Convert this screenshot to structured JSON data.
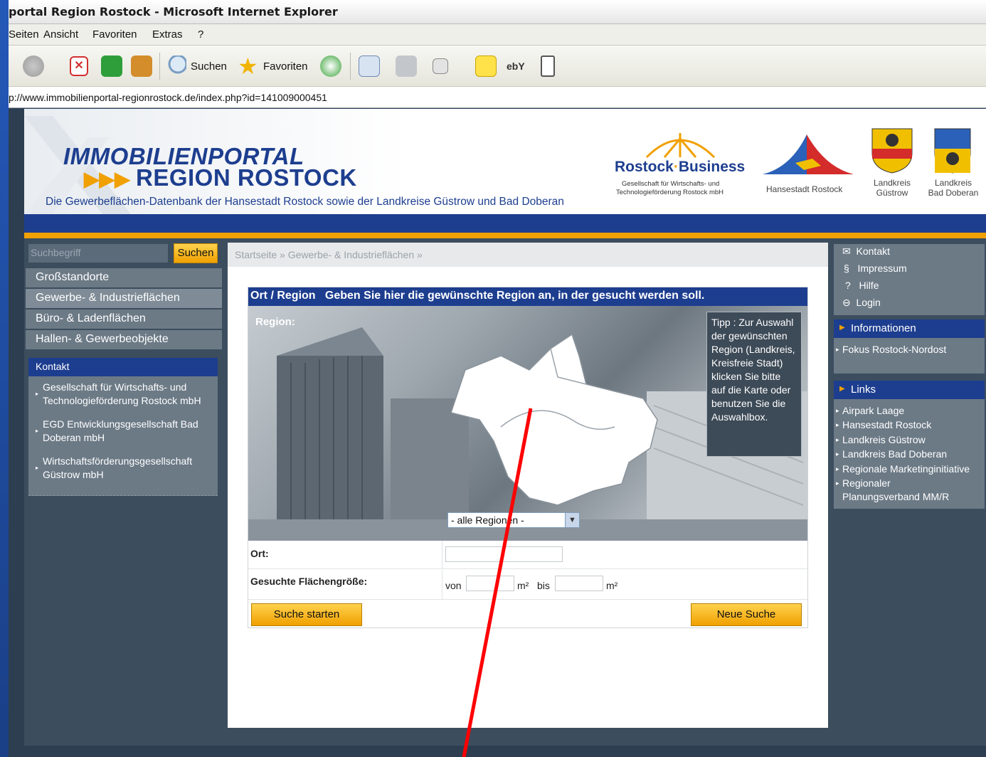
{
  "window": {
    "title": "portal Region Rostock - Microsoft Internet Explorer"
  },
  "menu": [
    "Seiten",
    "Ansicht",
    "Favoriten",
    "Extras",
    "?"
  ],
  "toolbar": {
    "search_label": "Suchen",
    "favorites_label": "Favoriten"
  },
  "address": {
    "url": "p://www.immobilienportal-regionrostock.de/index.php?id=141009000451"
  },
  "header": {
    "line1": "IMMOBILIENPORTAL",
    "arrows": "▶▶▶",
    "line2": "REGION ROSTOCK",
    "subtitle": "Die Gewerbeflächen-Datenbank der Hansestadt Rostock sowie der Landkreise Güstrow und Bad Doberan",
    "rb_name_1": "Rostock",
    "rb_name_dot": "·",
    "rb_name_2": "Business",
    "rb_sub1": "Gesellschaft für Wirtschafts- und",
    "rb_sub2": "Technologieförderung Rostock mbH",
    "hro": "Hansestadt Rostock",
    "crest1_a": "Landkreis",
    "crest1_b": "Güstrow",
    "crest2_a": "Landkreis",
    "crest2_b": "Bad Doberan"
  },
  "sidebar": {
    "search_placeholder": "Suchbegriff",
    "search_button": "Suchen",
    "nav": [
      "Großstandorte",
      "Gewerbe- & Industrieflächen",
      "Büro- & Ladenflächen",
      "Hallen- & Gewerbeobjekte"
    ],
    "kontakt_title": "Kontakt",
    "kontakt_items": [
      "Gesellschaft für Wirtschafts- und Technologieförderung Rostock mbH",
      "EGD Entwicklungsgesellschaft Bad Doberan mbH",
      "Wirtschaftsförderungsgesellschaft Güstrow mbH"
    ]
  },
  "main": {
    "breadcrumb": "Startseite » Gewerbe- & Industrieflächen »",
    "form_title": "Ort / Region",
    "form_hint": "Geben Sie hier die gewünschte Region an, in der gesucht werden soll.",
    "region_label": "Region:",
    "tip": "Tipp : Zur Auswahl der gewünschten Region (Landkreis, Kreisfreie Stadt) klicken Sie bitte auf die Karte oder benutzen Sie die Auswahlbox.",
    "region_select_value": "- alle Regionen -",
    "ort_label": "Ort:",
    "size_label": "Gesuchte Flächengröße:",
    "von": "von",
    "bis": "bis",
    "unit": "m²",
    "search_button": "Suche starten",
    "reset_button": "Neue Suche"
  },
  "right": {
    "top_links": [
      {
        "icon": "✉",
        "label": "Kontakt"
      },
      {
        "icon": "§",
        "label": "Impressum"
      },
      {
        "icon": "?",
        "label": "Hilfe"
      },
      {
        "icon": "⊖",
        "label": "Login"
      }
    ],
    "info_title": "Informationen",
    "info_links": [
      "Fokus Rostock-Nordost"
    ],
    "links_title": "Links",
    "links": [
      "Airpark Laage",
      "Hansestadt Rostock",
      "Landkreis Güstrow",
      "Landkreis Bad Doberan",
      "Regionale Marketinginitiative",
      "Regionaler Planungsverband MM/R"
    ]
  },
  "colors": {
    "brand_blue": "#1d3e8f",
    "accent_orange": "#f0a000",
    "annotation_red": "#ff0000"
  }
}
